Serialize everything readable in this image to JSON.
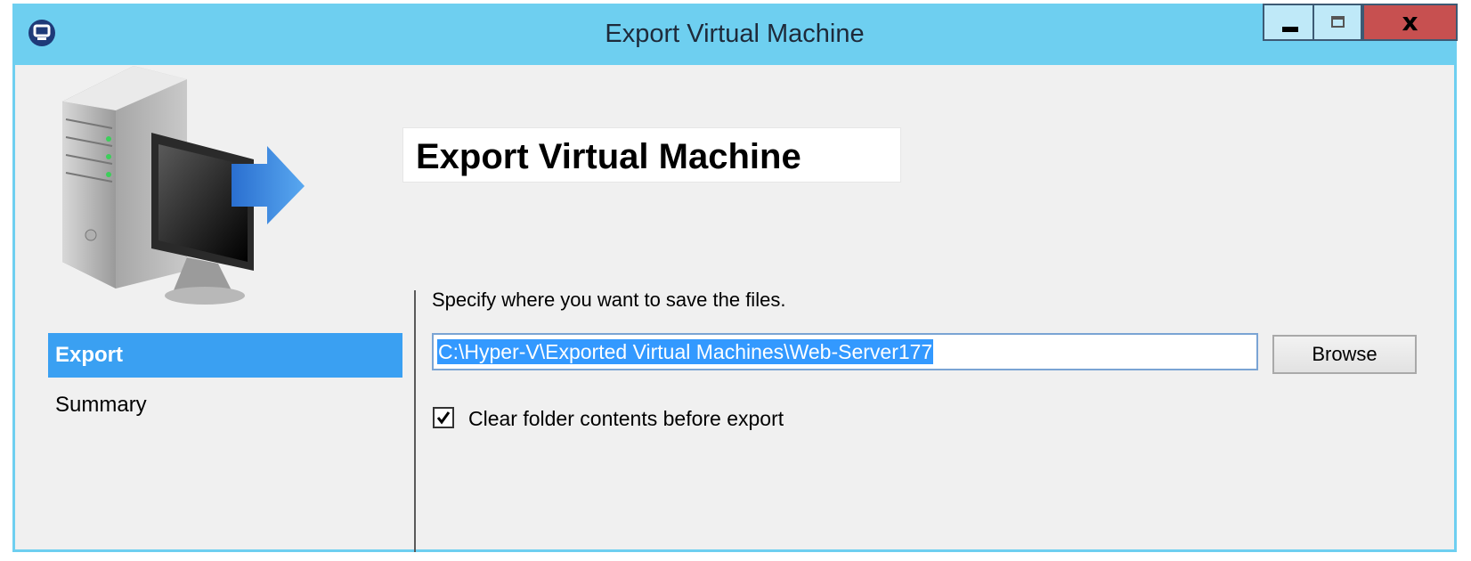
{
  "window": {
    "title": "Export Virtual Machine",
    "controls": {
      "minimize": "minimize",
      "maximize": "maximize",
      "close": "x"
    }
  },
  "wizard": {
    "heading": "Export Virtual Machine",
    "nav": [
      {
        "label": "Export",
        "selected": true
      },
      {
        "label": "Summary",
        "selected": false
      }
    ]
  },
  "form": {
    "instruction": "Specify where you want to save the files.",
    "path_value": "C:\\Hyper-V\\Exported Virtual Machines\\Web-Server177",
    "browse_label": "Browse",
    "clear_folder_label": "Clear folder contents before export",
    "clear_folder_checked": true
  },
  "colors": {
    "titlebar": "#6ecff0",
    "selection": "#3aa0f2",
    "close": "#c75050"
  },
  "icons": [
    "app-icon",
    "server-export-illustration",
    "checkmark-icon"
  ]
}
